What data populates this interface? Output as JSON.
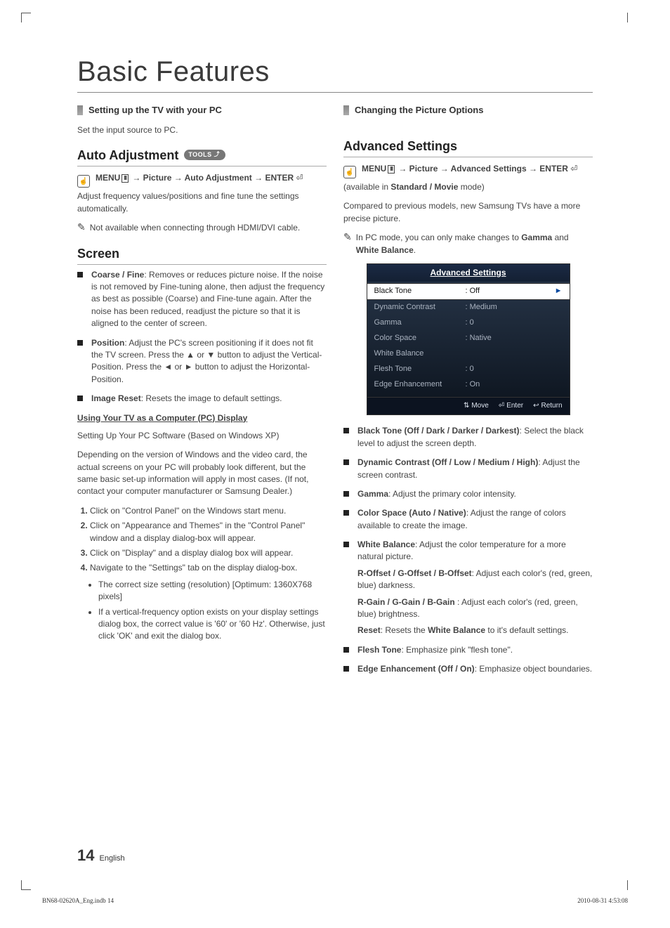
{
  "title": "Basic Features",
  "left": {
    "section1_header": "Setting up the TV with your PC",
    "section1_body": "Set the input source to PC.",
    "auto_adj_heading": "Auto Adjustment",
    "tools_label": "TOOLS",
    "nav1": "MENU Ⅲ → Picture → Auto Adjustment → ENTER",
    "auto_adj_body": "Adjust frequency values/positions and fine tune the settings automatically.",
    "auto_adj_note": "Not available when connecting through HDMI/DVI cable.",
    "screen_heading": "Screen",
    "screen_items": [
      {
        "label": "Coarse / Fine",
        "text": ": Removes or reduces picture noise. If the noise is not removed by Fine-tuning alone, then adjust the frequency as best as possible (Coarse) and Fine-tune again. After the noise has been reduced, readjust the picture so that it is aligned to the center of screen."
      },
      {
        "label": "Position",
        "text": ": Adjust the PC's screen positioning if it does not fit the TV screen. Press the ▲ or ▼ button to adjust the Vertical-Position. Press the ◄ or ► button to adjust the Horizontal-Position."
      },
      {
        "label": "Image Reset",
        "text": ": Resets the image to default settings."
      }
    ],
    "pc_display_heading": "Using Your TV as a Computer (PC) Display",
    "pc_display_intro1": "Setting Up Your PC Software (Based on Windows XP)",
    "pc_display_intro2": "Depending on the version of Windows and the video card, the actual screens on your PC will probably look different, but the same basic set-up information will apply in most cases. (If not, contact your computer manufacturer or Samsung Dealer.)",
    "steps": [
      "Click on \"Control Panel\" on the Windows start menu.",
      "Click on \"Appearance and Themes\" in the \"Control Panel\" window and a display dialog-box will appear.",
      "Click on \"Display\" and a display dialog box will appear.",
      "Navigate to the \"Settings\" tab on the display dialog-box."
    ],
    "bullets": [
      "The correct size setting (resolution) [Optimum: 1360X768 pixels]",
      "If a vertical-frequency option exists on your display settings dialog box, the correct value is '60' or '60 Hz'. Otherwise, just click 'OK' and exit the dialog box."
    ]
  },
  "right": {
    "section_header": "Changing the Picture Options",
    "adv_heading": "Advanced Settings",
    "nav2": "MENU Ⅲ → Picture → Advanced Settings → ENTER",
    "avail_prefix": "(available in ",
    "avail_bold": "Standard / Movie",
    "avail_suffix": " mode)",
    "adv_body2": "Compared to previous models, new Samsung TVs have a more precise picture.",
    "adv_note_pre": "In PC mode, you can only make changes to ",
    "adv_note_b1": "Gamma",
    "adv_note_mid": " and ",
    "adv_note_b2": "White Balance",
    "adv_note_post": ".",
    "osd_title": "Advanced Settings",
    "osd_rows": [
      {
        "k": "Black Tone",
        "v": ": Off",
        "sel": true
      },
      {
        "k": "Dynamic Contrast",
        "v": ": Medium"
      },
      {
        "k": "Gamma",
        "v": ": 0"
      },
      {
        "k": "Color Space",
        "v": ": Native"
      },
      {
        "k": "White Balance",
        "v": ""
      },
      {
        "k": "Flesh Tone",
        "v": ": 0"
      },
      {
        "k": "Edge Enhancement",
        "v": ": On"
      }
    ],
    "osd_foot": {
      "move": "Move",
      "enter": "Enter",
      "return": "Return"
    },
    "items": [
      {
        "label": "Black Tone (Off / Dark / Darker / Darkest)",
        "text": ": Select the black level to adjust the screen depth."
      },
      {
        "label": "Dynamic Contrast (Off / Low / Medium / High)",
        "text": ": Adjust the screen contrast."
      },
      {
        "label": "Gamma",
        "text": ": Adjust the primary color intensity."
      },
      {
        "label": "Color Space (Auto / Native)",
        "text": ": Adjust the range of colors available to create the image."
      },
      {
        "label": "White Balance",
        "text": ": Adjust the color temperature for a more natural picture."
      },
      {
        "label": "Flesh Tone",
        "text": ": Emphasize pink \"flesh tone\"."
      },
      {
        "label": "Edge Enhancement (Off / On)",
        "text": ": Emphasize object boundaries."
      }
    ],
    "wb_sub": [
      {
        "label": "R-Offset / G-Offset / B-Offset",
        "text": ": Adjust each color's (red, green, blue) darkness."
      },
      {
        "label": "R-Gain / G-Gain / B-Gain ",
        "text": ": Adjust each color's (red, green, blue) brightness."
      },
      {
        "label": "Reset",
        "text_pre": ": Resets the ",
        "text_b": "White Balance",
        "text_post": " to it's default settings."
      }
    ]
  },
  "footer_page": "14",
  "footer_lang": "English",
  "print_id": "BN68-02620A_Eng.indb   14",
  "print_ts": "2010-08-31    4:53:08"
}
